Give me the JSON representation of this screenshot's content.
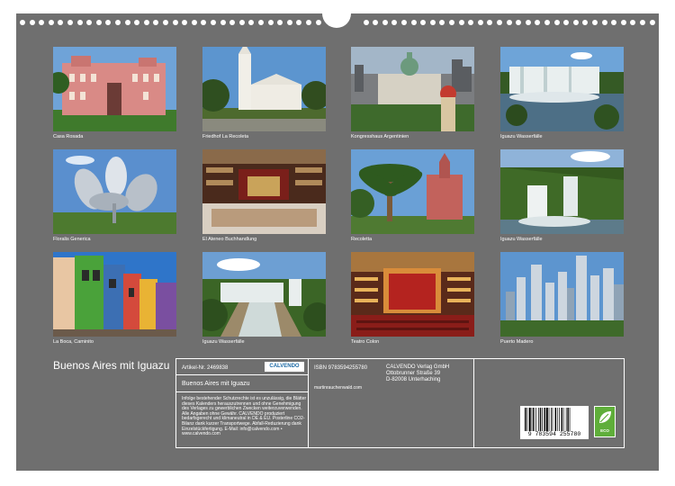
{
  "calendar": {
    "title": "Buenos Aires mit Iguazu"
  },
  "photos": [
    {
      "caption": "Casa Rosada",
      "theme": "pink-palace"
    },
    {
      "caption": "Friedhof La Recoleta",
      "theme": "white-church"
    },
    {
      "caption": "Kongresshaus Argentinien",
      "theme": "congress"
    },
    {
      "caption": "Iguazu Wasserfälle",
      "theme": "waterfall-wide"
    },
    {
      "caption": "Floralis Generica",
      "theme": "flower-sculpture"
    },
    {
      "caption": "El Ateneo Buchhandlung",
      "theme": "theatre-bookstore"
    },
    {
      "caption": "Recoletta",
      "theme": "palm-church"
    },
    {
      "caption": "Iguazu Wasserfälle",
      "theme": "waterfall-jungle"
    },
    {
      "caption": "La Boca, Caminito",
      "theme": "colorful-houses"
    },
    {
      "caption": "Iguazu Wasserfälle",
      "theme": "waterfall-river"
    },
    {
      "caption": "Teatro Colon",
      "theme": "opera-red"
    },
    {
      "caption": "Puerto Madero",
      "theme": "skyline"
    }
  ],
  "info": {
    "article_label": "Artikel-Nr. 2469838",
    "publisher_logo": "CALVENDO",
    "product_title": "Buenos Aires mit Iguazu",
    "legal_text": "Infolge bestehender Schutzrechte ist es unzulässig, die Blätter dieses Kalenders herauszutrennen und ohne Genehmigung des Verlages zu gewerblichen Zwecken weiterzuverwenden. Alle Angaben ohne Gewähr. CALVENDO produziert bedarfsgerecht und klimaneutral in DE & EU. Posterline CO2-Bilanz dank kurzer Transportwege. Abfall-Reduzierung dank Einzelstückfertigung. E-Mail: info@calvendo.com • www.calvendo.com",
    "isbn": "ISBN 9783594255780",
    "author_site": "martinrauchenwald.com",
    "publisher_name": "CALVENDO Verlag GmbH",
    "publisher_street": "Ottobrunner Straße 39",
    "publisher_city": "D-82008 Unterhaching",
    "barcode_number": "9 783594 255780",
    "eco_label": "ECO"
  },
  "colors": {
    "background": "#6f6f6f",
    "text": "#ffffff"
  }
}
